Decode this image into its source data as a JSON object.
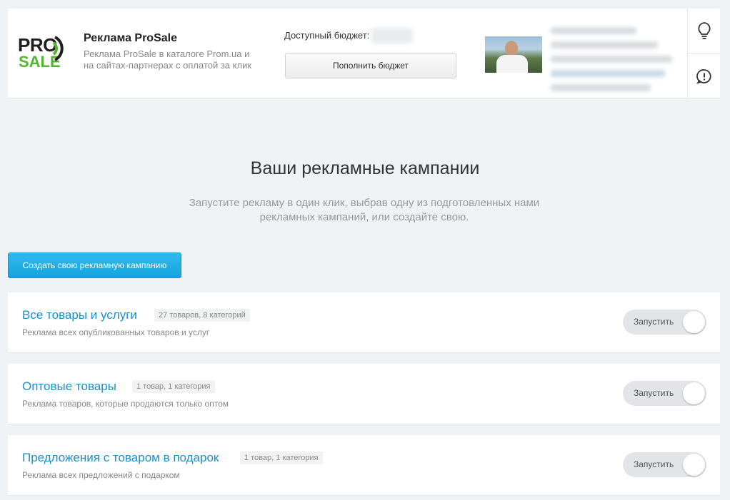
{
  "header": {
    "logo_top": "PRO",
    "logo_bottom": "SALE",
    "title": "Реклама ProSale",
    "description": "Реклама ProSale в каталоге Prom.ua и на сайтах-партнерах с оплатой за клик",
    "budget_label": "Доступный бюджет:",
    "topup_label": "Пополнить бюджет",
    "icons": [
      "lightbulb-icon",
      "exclamation-icon"
    ]
  },
  "main": {
    "title": "Ваши рекламные кампании",
    "subtitle": "Запустите рекламу в один клик, выбрав одну из подготовленных нами рекламных кампаний, или создайте свою.",
    "create_label": "Создать свою рекламную кампанию"
  },
  "campaigns": [
    {
      "title": "Все товары и услуги",
      "badge": "27 товаров, 8 категорий",
      "description": "Реклама всех опубликованных товаров и услуг",
      "toggle_label": "Запустить"
    },
    {
      "title": "Оптовые товары",
      "badge": "1 товар, 1 категория",
      "description": "Реклама товаров, которые продаются только оптом",
      "toggle_label": "Запустить"
    },
    {
      "title": "Предложения с товаром в подарок",
      "badge": "1 товар, 1 категория",
      "description": "Реклама всех предложений с подарком",
      "toggle_label": "Запустить"
    }
  ],
  "colors": {
    "accent": "#1e8fc6",
    "button_blue": "#12a5de",
    "logo_green": "#55b42f",
    "background": "#eef2f4"
  }
}
